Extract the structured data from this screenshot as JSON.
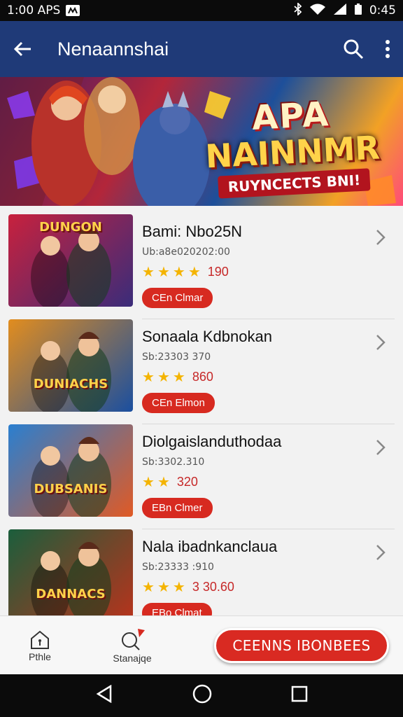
{
  "status_bar": {
    "time_left": "1:00 APS",
    "time_right": "0:45"
  },
  "app_bar": {
    "title": "Nenaannshai"
  },
  "banner": {
    "line1": "APA",
    "line2": "NAINNMR",
    "tagline": "RUYNCECTS BNI!"
  },
  "items": [
    {
      "name": "Bami: Nbo25N",
      "sub": "Ub:a8e020202:00",
      "stars": 3.5,
      "count": "190",
      "cta": "CEn Clmar",
      "thumb_label": "DUNGON",
      "thumb_colors": [
        "#c8213d",
        "#3a2c7a"
      ]
    },
    {
      "name": "Sonaala Kdbnokan",
      "sub": "Sb:23303 370",
      "stars": 3,
      "count": "860",
      "cta": "CEn Elmon",
      "thumb_label": "DUNIACHS",
      "thumb_colors": [
        "#e28d1e",
        "#1a4fa0"
      ]
    },
    {
      "name": "Diolgaislanduthodaa",
      "sub": "Sb:3302.310",
      "stars": 2,
      "count": "320",
      "cta": "EBn Clmer",
      "thumb_label": "DUBSANIS",
      "thumb_colors": [
        "#2a7fd0",
        "#e05a25"
      ]
    },
    {
      "name": "Nala ibadnkanclaua",
      "sub": "Sb:23333 :910",
      "stars": 2.5,
      "count": "3 30.60",
      "cta": "EBo Clmat",
      "thumb_label": "DANNACS",
      "thumb_colors": [
        "#1b5e3c",
        "#b8331c"
      ]
    }
  ],
  "bottom_bar": {
    "tab1": "Pthle",
    "tab2": "Stanajqe",
    "primary": "CEENNS IBONBEES"
  },
  "colors": {
    "app_bar": "#1f3a78",
    "accent": "#d72a20",
    "star": "#f4b400"
  }
}
